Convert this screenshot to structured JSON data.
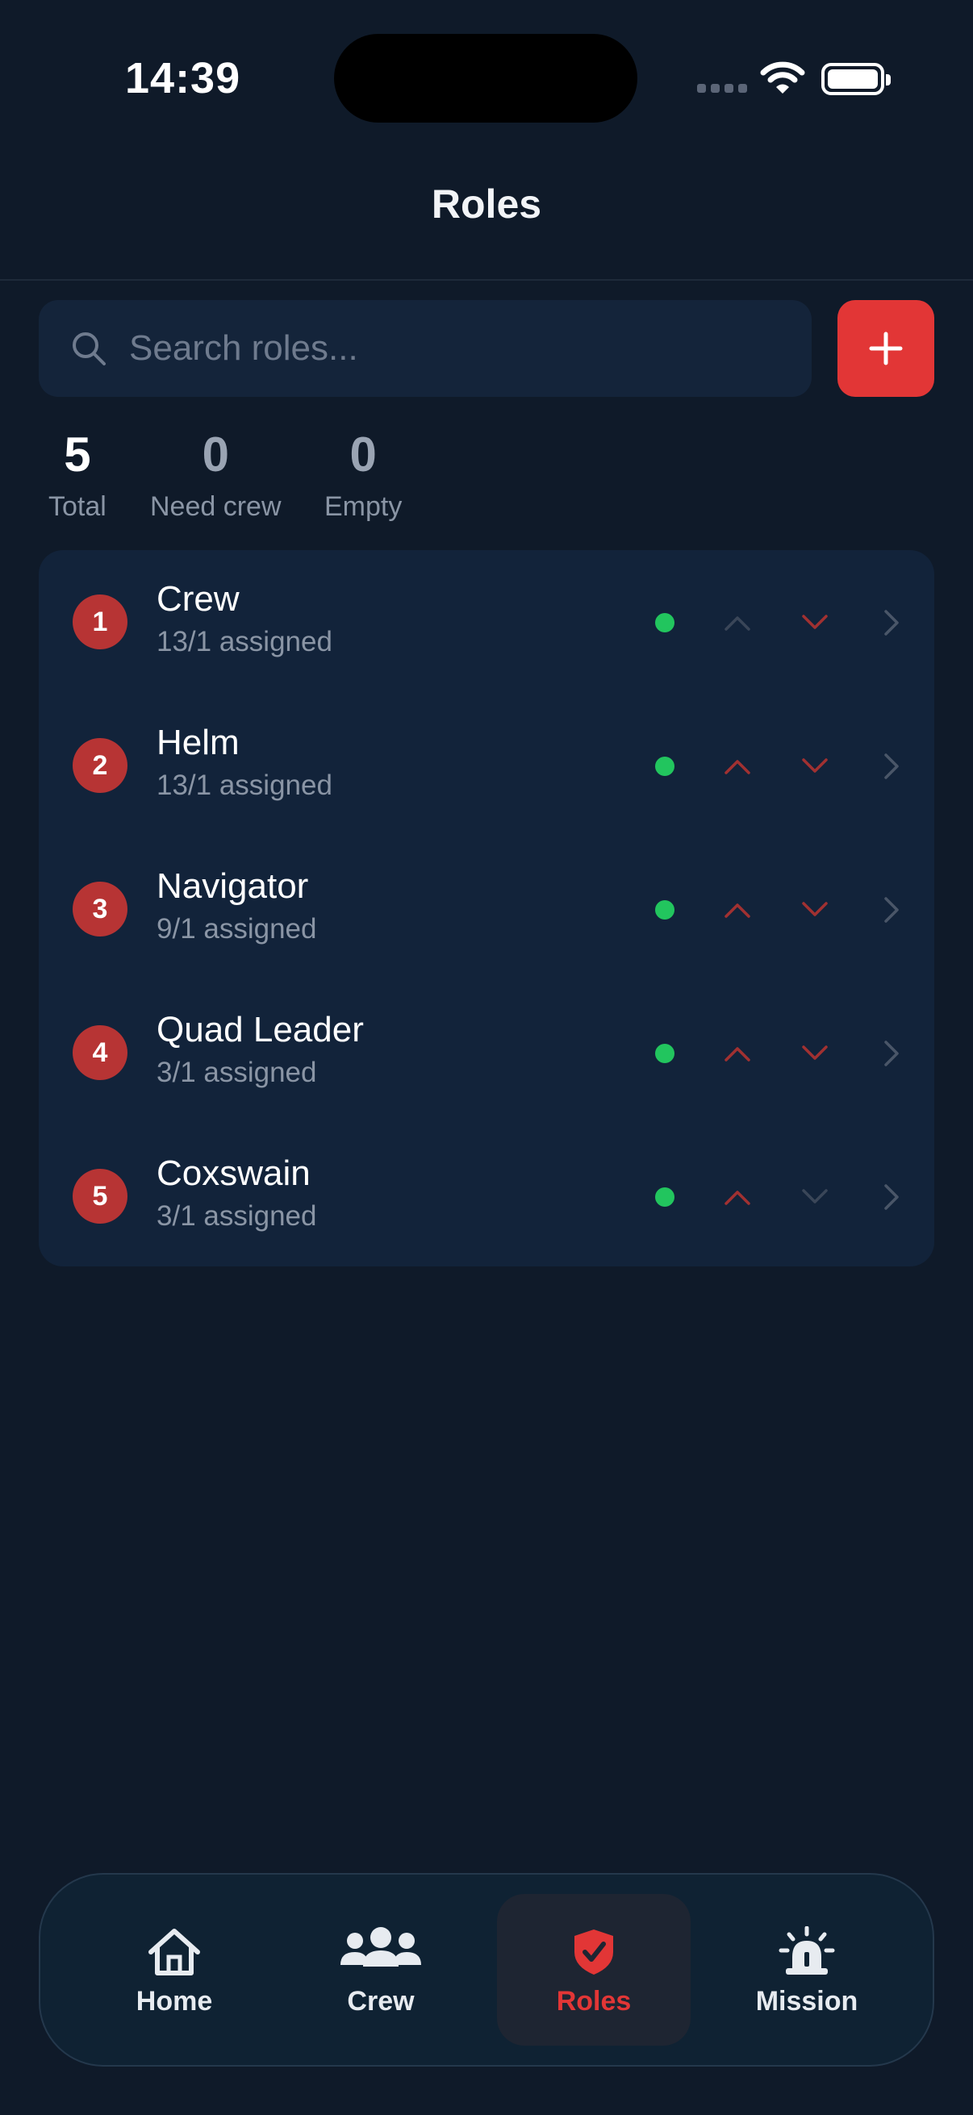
{
  "status_bar": {
    "time": "14:39"
  },
  "header": {
    "title": "Roles"
  },
  "search": {
    "placeholder": "Search roles..."
  },
  "stats": [
    {
      "value": "5",
      "label": "Total"
    },
    {
      "value": "0",
      "label": "Need crew"
    },
    {
      "value": "0",
      "label": "Empty"
    }
  ],
  "roles": [
    {
      "number": "1",
      "name": "Crew",
      "assigned": "13/1 assigned",
      "status": "ok",
      "can_move_up": false,
      "can_move_down": true
    },
    {
      "number": "2",
      "name": "Helm",
      "assigned": "13/1 assigned",
      "status": "ok",
      "can_move_up": true,
      "can_move_down": true
    },
    {
      "number": "3",
      "name": "Navigator",
      "assigned": "9/1 assigned",
      "status": "ok",
      "can_move_up": true,
      "can_move_down": true
    },
    {
      "number": "4",
      "name": "Quad Leader",
      "assigned": "3/1 assigned",
      "status": "ok",
      "can_move_up": true,
      "can_move_down": true
    },
    {
      "number": "5",
      "name": "Coxswain",
      "assigned": "3/1 assigned",
      "status": "ok",
      "can_move_up": true,
      "can_move_down": false
    }
  ],
  "tabs": [
    {
      "label": "Home",
      "icon": "home-icon",
      "active": false
    },
    {
      "label": "Crew",
      "icon": "people-icon",
      "active": false
    },
    {
      "label": "Roles",
      "icon": "shield-check-icon",
      "active": true
    },
    {
      "label": "Mission",
      "icon": "siren-icon",
      "active": false
    }
  ],
  "colors": {
    "background": "#0f1a29",
    "accent": "#e23636",
    "badge": "#b73434",
    "status_ok": "#22c55e",
    "card": "#12233a"
  }
}
